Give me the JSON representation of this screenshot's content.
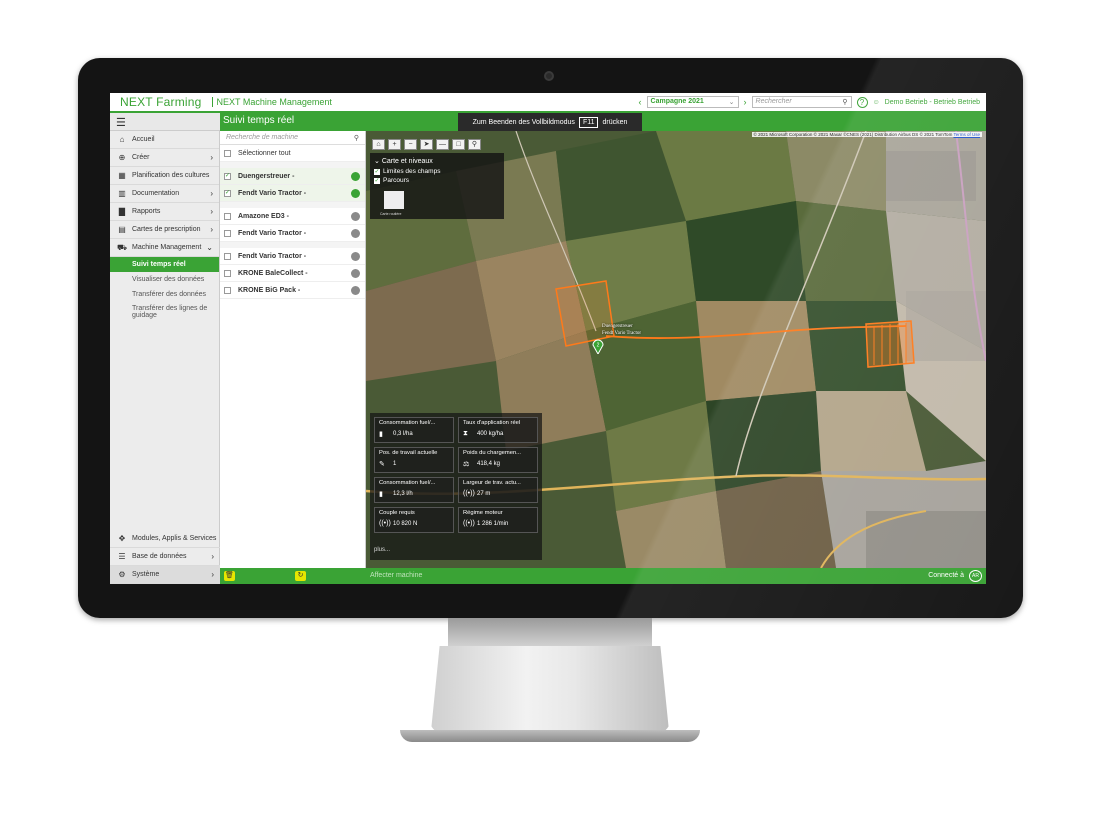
{
  "app": {
    "brand": "NEXT Farming",
    "module": "NEXT Machine Management"
  },
  "header": {
    "campaign": "Campagne 2021",
    "search_placeholder": "Rechercher",
    "user": "Demo Betrieb - Betrieb Betrieb"
  },
  "page": {
    "title": "Suivi temps réel",
    "fullscreen_banner": {
      "before": "Zum Beenden des Vollbildmodus",
      "key": "F11",
      "after": "drücken"
    }
  },
  "sidebar": {
    "items": [
      {
        "label": "Accueil",
        "icon": "home-icon",
        "glyph": "⌂",
        "arrow": ""
      },
      {
        "label": "Créer",
        "icon": "plus-circle-icon",
        "glyph": "⊕",
        "arrow": "›"
      },
      {
        "label": "Planification des cultures",
        "icon": "calendar-icon",
        "glyph": "▦",
        "arrow": ""
      },
      {
        "label": "Documentation",
        "icon": "trash-doc-icon",
        "glyph": "▥",
        "arrow": "›"
      },
      {
        "label": "Rapports",
        "icon": "bar-chart-icon",
        "glyph": "▇",
        "arrow": "›"
      },
      {
        "label": "Cartes de prescription",
        "icon": "map-doc-icon",
        "glyph": "▤",
        "arrow": "›"
      },
      {
        "label": "Machine Management",
        "icon": "tractor-icon",
        "glyph": "⛟",
        "arrow": "⌄"
      }
    ],
    "subitems": [
      "Suivi temps réel",
      "Visualiser des données",
      "Transférer des données",
      "Transférer des lignes de guidage"
    ],
    "bottom": [
      {
        "label": "Modules, Applis & Services",
        "icon": "puzzle-icon",
        "glyph": "✥",
        "arrow": ""
      },
      {
        "label": "Base de données",
        "icon": "database-icon",
        "glyph": "☰",
        "arrow": "›"
      },
      {
        "label": "Système",
        "icon": "gear-icon",
        "glyph": "⚙",
        "arrow": "›"
      }
    ]
  },
  "machines": {
    "search_placeholder": "Recherche de machine",
    "select_all": "Sélectionner tout",
    "groups": [
      [
        {
          "name": "Duengerstreuer -",
          "checked": true,
          "online": true
        },
        {
          "name": "Fendt Vario Tractor -",
          "checked": true,
          "online": true
        }
      ],
      [
        {
          "name": "Amazone ED3 -",
          "checked": false,
          "online": false
        },
        {
          "name": "Fendt Vario Tractor -",
          "checked": false,
          "online": false
        }
      ],
      [
        {
          "name": "Fendt Vario Tractor -",
          "checked": false,
          "online": false
        },
        {
          "name": "KRONE BaleCollect -",
          "checked": false,
          "online": false
        },
        {
          "name": "KRONE BiG Pack -",
          "checked": false,
          "online": false
        }
      ]
    ]
  },
  "map": {
    "attribution": "© 2021 Microsoft Corporation © 2021 Maxar ©CNES (2021) Distribution Airbus DS © 2021 TomTom",
    "terms": "Terms of Use",
    "layers_title": "Carte et niveaux",
    "layer_items": [
      "Limites des champs",
      "Parcours"
    ],
    "basemap_label": "Carte routière",
    "machine_labels": [
      "Duengerstreuer",
      "Fendt Vario Tractor"
    ],
    "pin_number": "2",
    "telemetry": [
      {
        "label": "Consommation fuel/...",
        "value": "0,3 l/ha",
        "icon": "fuel-icon",
        "glyph": "▮"
      },
      {
        "label": "Taux d'application réel",
        "value": "400 kg/ha",
        "icon": "hourglass-icon",
        "glyph": "⧗"
      },
      {
        "label": "Pos. de travail actuelle",
        "value": "1",
        "icon": "pen-icon",
        "glyph": "✎"
      },
      {
        "label": "Poids du chargemen...",
        "value": "418,4 kg",
        "icon": "scale-icon",
        "glyph": "⚖"
      },
      {
        "label": "Consommation fuel/...",
        "value": "12,3 l/h",
        "icon": "fuel-icon",
        "glyph": "▮"
      },
      {
        "label": "Largeur de trav. actu...",
        "value": "27 m",
        "icon": "signal-icon",
        "glyph": "((•))"
      },
      {
        "label": "Couple requis",
        "value": "10 820 N",
        "icon": "signal-icon",
        "glyph": "((•))"
      },
      {
        "label": "Régime moteur",
        "value": "1 286 1/min",
        "icon": "signal-icon",
        "glyph": "((•))"
      }
    ],
    "more": "plus..."
  },
  "footer": {
    "assign": "Affecter machine",
    "connected": "Connecté à",
    "logo_text": "AR"
  },
  "colors": {
    "accent": "#3aa335",
    "offline": "#8a8a8a",
    "track": "#ff7a1a"
  }
}
